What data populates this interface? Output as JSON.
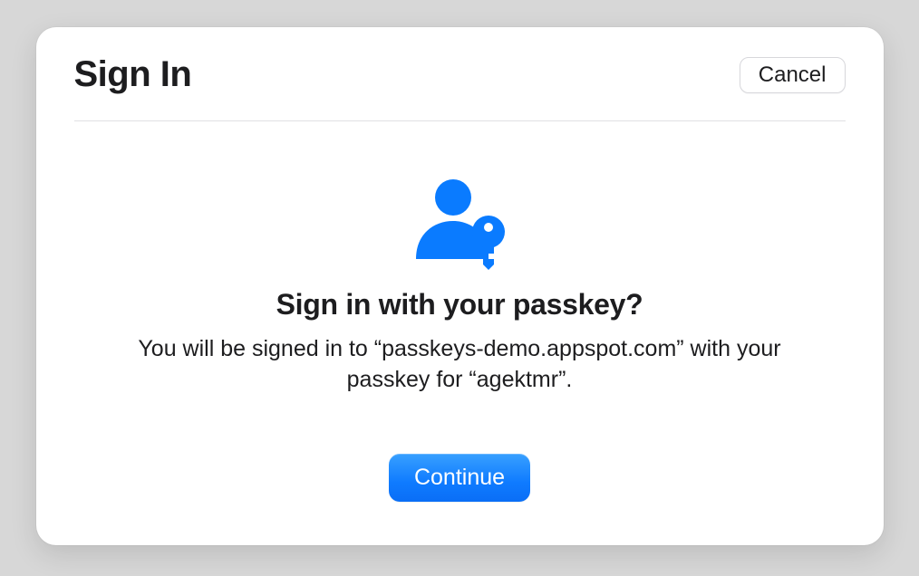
{
  "dialog": {
    "title": "Sign In",
    "cancel_label": "Cancel",
    "question": "Sign in with your passkey?",
    "description": "You will be signed in to “passkeys-demo.appspot.com” with your passkey for “agektmr”.",
    "continue_label": "Continue"
  },
  "colors": {
    "accent": "#0a7bff"
  }
}
